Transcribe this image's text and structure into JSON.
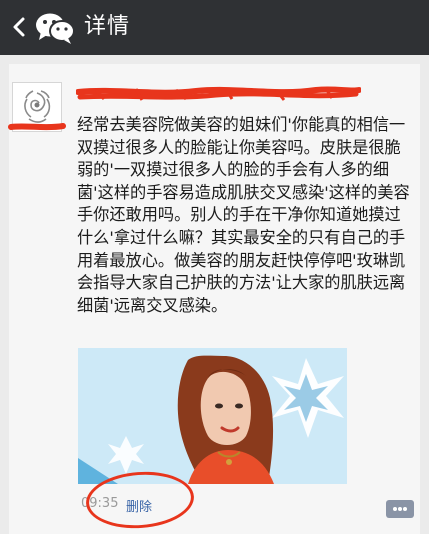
{
  "header": {
    "back_icon": "chevron-left-icon",
    "app_icon": "wechat-icon",
    "title": "详情"
  },
  "post": {
    "avatar_icon": "floral-avatar-icon",
    "author_name_redacted": true,
    "text": "经常去美容院做美容的姐妹们'你能真的相信一双摸过很多人的脸能让你美容吗。皮肤是很脆弱的'一双摸过很多人的脸的手会有人多的细菌'这样的手容易造成肌肤交叉感染'这样的美容手你还敢用吗。别人的手在干净你知道她摸过什么'拿过什么嘛？其实最安全的只有自己的手用着最放心。做美容的朋友赶快停停吧'玫琳凯会指导大家自己护肤的方法'让大家的肌肤远离细菌'远离交叉感染。",
    "image_alt": "woman-portrait",
    "time": "09:35",
    "delete_label": "删除",
    "comment_icon": "comment-more-icon"
  },
  "colors": {
    "header_bg": "#2f3134",
    "link_blue": "#3a65a7",
    "annotation_red": "#e8351c"
  }
}
